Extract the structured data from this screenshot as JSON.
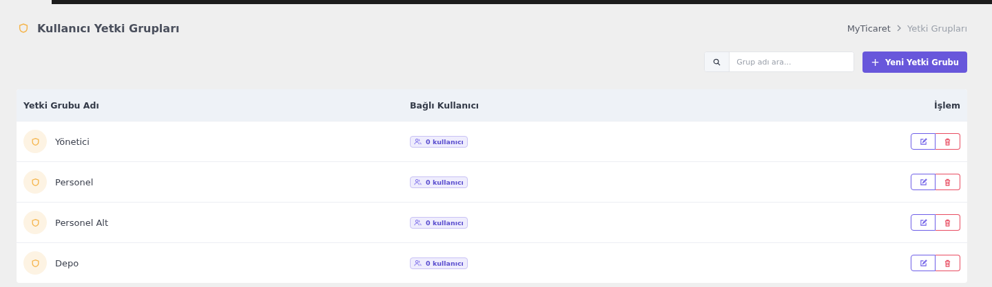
{
  "page_title": "Kullanıcı Yetki Grupları",
  "breadcrumb": [
    "MyTicaret",
    "Yetki Grupları"
  ],
  "search": {
    "placeholder": "Grup adı ara..."
  },
  "new_button": {
    "icon": "+",
    "label": "Yeni Yetki Grubu"
  },
  "table": {
    "columns": [
      "Yetki Grubu Adı",
      "Bağlı Kullanıcı",
      "İşlem"
    ],
    "rows": [
      {
        "name": "Yönetici",
        "users": "0 kullanıcı"
      },
      {
        "name": "Personel",
        "users": "0 kullanıcı"
      },
      {
        "name": "Personel Alt",
        "users": "0 kullanıcı"
      },
      {
        "name": "Depo",
        "users": "0 kullanıcı"
      }
    ]
  }
}
